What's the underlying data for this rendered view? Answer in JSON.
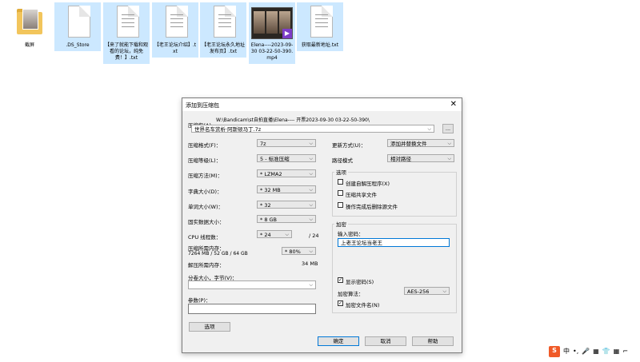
{
  "desktop": {
    "files": [
      {
        "name": "截屏",
        "type": "folder"
      },
      {
        "name": ".DS_Store",
        "type": "doc"
      },
      {
        "name": "【来了就能下载和观看的论坛，纯免费！】.txt",
        "type": "txt"
      },
      {
        "name": "【老王论坛介绍】.txt",
        "type": "txt"
      },
      {
        "name": "【老王论坛永久地址发布页】.txt",
        "type": "txt"
      },
      {
        "name": "Elena----2023-09-30 03-22-50-390.mp4",
        "type": "video"
      },
      {
        "name": "获取最新地址.txt",
        "type": "txt"
      }
    ]
  },
  "dialog": {
    "title": "添加到压缩包",
    "close": "✕",
    "archive_label": "压缩包(A)",
    "archive_path": "W:\\Bandicam\\st自拍直播\\Elena---- 开票2023-09-30 03-22-50-390\\",
    "archive_name": "世界名车赏析·阿斯顿马丁.7z",
    "browse": "...",
    "left": [
      {
        "label": "压缩格式(F)：",
        "value": "7z"
      },
      {
        "label": "压缩等级(L)：",
        "value": "5 - 标准压缩"
      },
      {
        "label": "压缩方法(M)：",
        "value": "* LZMA2"
      },
      {
        "label": "字典大小(D)：",
        "value": "* 32 MB"
      },
      {
        "label": "单词大小(W)：",
        "value": "* 32"
      },
      {
        "label": "固实数据大小：",
        "value": "* 8 GB"
      }
    ],
    "cpu_label": "CPU 线程数：",
    "cpu_value": "* 24",
    "cpu_total": "/ 24",
    "mem_label": "压缩所需内存：",
    "mem_detail": "7264 MB / 52 GB / 64 GB",
    "mem_value": "* 80%",
    "decomp_label": "解压所需内存：",
    "decomp_value": "34 MB",
    "split_label": "分卷大小，字节(V)：",
    "params_label": "参数(P)：",
    "options_button": "选项",
    "update_label": "更新方式(U)：",
    "update_value": "添加并替换文件",
    "path_label": "路径模式",
    "path_value": "相对路径",
    "options_group": "选项",
    "options": [
      {
        "label": "创建自解压程序(X)",
        "checked": false
      },
      {
        "label": "压缩共享文件",
        "checked": false
      },
      {
        "label": "操作完成后删除源文件",
        "checked": false
      }
    ],
    "encrypt_group": "加密",
    "password_label": "输入密码：",
    "password_value": "上老王论坛当老王",
    "show_password": "显示密码(S)",
    "show_password_checked": true,
    "enc_method_label": "加密算法：",
    "enc_method_value": "AES-256",
    "encrypt_names": "加密文件名(N)",
    "encrypt_names_checked": true,
    "ok": "确定",
    "cancel": "取消",
    "help": "帮助"
  },
  "tray": {
    "items": [
      "S",
      "中",
      "•,",
      "🎤",
      "▦",
      "👕",
      "▦",
      "⌐"
    ]
  }
}
